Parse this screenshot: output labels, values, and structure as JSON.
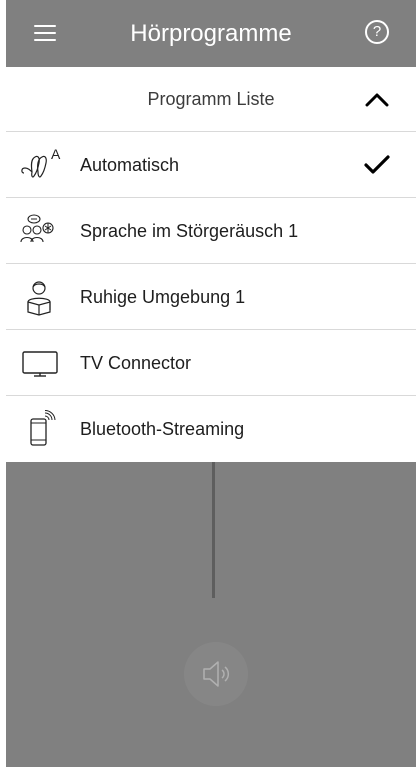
{
  "header": {
    "title": "Hörprogramme",
    "menu_icon": "menu-icon",
    "help_symbol": "?"
  },
  "program_list": {
    "title": "Programm Liste",
    "expanded": true,
    "items": [
      {
        "label": "Automatisch",
        "icon": "hearing-aid-auto-icon",
        "selected": true
      },
      {
        "label": "Sprache im Störgeräusch 1",
        "icon": "speech-in-noise-icon",
        "selected": false
      },
      {
        "label": "Ruhige Umgebung 1",
        "icon": "quiet-environment-icon",
        "selected": false
      },
      {
        "label": "TV Connector",
        "icon": "tv-icon",
        "selected": false
      },
      {
        "label": "Bluetooth-Streaming",
        "icon": "phone-streaming-icon",
        "selected": false
      }
    ]
  },
  "colors": {
    "header_bg": "#808080",
    "overlay_bg": "#808080",
    "divider": "#d9d9d9",
    "text": "#1e1e1e"
  }
}
